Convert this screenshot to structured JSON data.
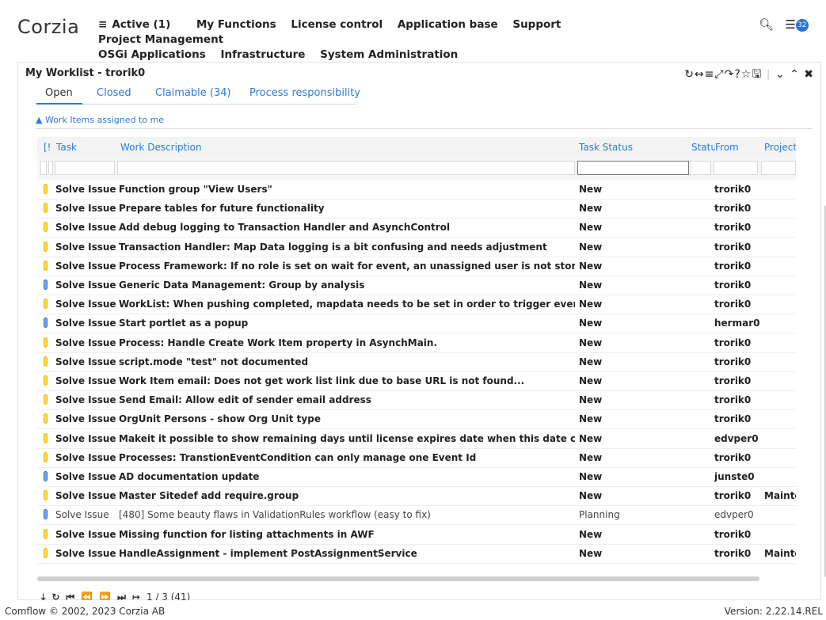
{
  "app": {
    "logo": "Corzia",
    "nav": [
      {
        "icon": "≡",
        "label": "Active (1)"
      },
      {
        "icon": "",
        "label": "My Functions"
      },
      {
        "icon": "",
        "label": "License control"
      },
      {
        "icon": "",
        "label": "Application base"
      },
      {
        "icon": "",
        "label": "Support"
      },
      {
        "icon": "",
        "label": "Project Management"
      },
      {
        "icon": "",
        "label": "OSGi Applications"
      },
      {
        "icon": "",
        "label": "Infrastructure"
      },
      {
        "icon": "",
        "label": "System Administration"
      }
    ],
    "badge": "32"
  },
  "panel": {
    "title": "My Worklist - trorik0",
    "icons": [
      "refresh-icon",
      "resize-icon",
      "menu-icon",
      "fullscreen-icon",
      "share-icon",
      "help-icon",
      "star-icon",
      "save-icon",
      "collapse-icon",
      "expand-icon",
      "close-icon"
    ]
  },
  "tabs": [
    {
      "label": "Open",
      "active": true
    },
    {
      "label": "Closed",
      "active": false
    },
    {
      "label": "Claimable (34)",
      "active": false
    },
    {
      "label": "Process responsibility",
      "active": false
    }
  ],
  "section": {
    "label": "Work Items assigned to me"
  },
  "columns": [
    {
      "key": "prio",
      "label": "[!"
    },
    {
      "key": "task",
      "label": "Task"
    },
    {
      "key": "desc",
      "label": "Work Description"
    },
    {
      "key": "status",
      "label": "Task Status"
    },
    {
      "key": "state",
      "label": "Statu"
    },
    {
      "key": "from",
      "label": "From"
    },
    {
      "key": "project",
      "label": "Project"
    }
  ],
  "rows": [
    {
      "prio": "yellow",
      "task": "Solve Issue",
      "desc": "Function group \"View Users\"",
      "status": "New",
      "from": "trorik0",
      "project": ""
    },
    {
      "prio": "yellow",
      "task": "Solve Issue",
      "desc": "Prepare tables for future functionality",
      "status": "New",
      "from": "trorik0",
      "project": ""
    },
    {
      "prio": "yellow",
      "task": "Solve Issue",
      "desc": "Add debug logging to Transaction Handler and AsynchControl",
      "status": "New",
      "from": "trorik0",
      "project": ""
    },
    {
      "prio": "yellow",
      "task": "Solve Issue",
      "desc": "Transaction Handler: Map Data logging is a bit confusing and needs adjustment",
      "status": "New",
      "from": "trorik0",
      "project": ""
    },
    {
      "prio": "yellow",
      "task": "Solve Issue",
      "desc": "Process Framework: If no role is set on wait for event, an unassigned user is not stored as ToUser",
      "status": "New",
      "from": "trorik0",
      "project": ""
    },
    {
      "prio": "blue",
      "task": "Solve Issue",
      "desc": "Generic Data Management: Group by analysis",
      "status": "New",
      "from": "trorik0",
      "project": ""
    },
    {
      "prio": "yellow",
      "task": "Solve Issue",
      "desc": "WorkList: When pushing completed, mapdata needs to be set in order to trigger event.",
      "status": "New",
      "from": "trorik0",
      "project": ""
    },
    {
      "prio": "blue",
      "task": "Solve Issue",
      "desc": "Start portlet as a popup",
      "status": "New",
      "from": "hermar0",
      "project": ""
    },
    {
      "prio": "yellow",
      "task": "Solve Issue",
      "desc": "Process: Handle Create Work Item property in AsynchMain.",
      "status": "New",
      "from": "trorik0",
      "project": ""
    },
    {
      "prio": "yellow",
      "task": "Solve Issue",
      "desc": "script.mode \"test\" not documented",
      "status": "New",
      "from": "trorik0",
      "project": ""
    },
    {
      "prio": "yellow",
      "task": "Solve Issue",
      "desc": "Work Item email: Does not get work list link due to base URL is not found...",
      "status": "New",
      "from": "trorik0",
      "project": ""
    },
    {
      "prio": "yellow",
      "task": "Solve Issue",
      "desc": "Send Email: Allow edit of sender email address",
      "status": "New",
      "from": "trorik0",
      "project": ""
    },
    {
      "prio": "yellow",
      "task": "Solve Issue",
      "desc": "OrgUnit Persons - show Org Unit type",
      "status": "New",
      "from": "trorik0",
      "project": ""
    },
    {
      "prio": "yellow",
      "task": "Solve Issue",
      "desc": "Makeit it possible to show remaining days until license expires date when this date comes close",
      "status": "New",
      "from": "edvper0",
      "project": ""
    },
    {
      "prio": "yellow",
      "task": "Solve Issue",
      "desc": "Processes: TranstionEventCondition can only manage one Event Id",
      "status": "New",
      "from": "trorik0",
      "project": ""
    },
    {
      "prio": "blue",
      "task": "Solve Issue",
      "desc": "AD documentation update",
      "status": "New",
      "from": "junste0",
      "project": ""
    },
    {
      "prio": "yellow",
      "task": "Solve Issue",
      "desc": "Master Sitedef add require.group",
      "status": "New",
      "from": "trorik0",
      "project": "Maintenar"
    },
    {
      "prio": "blue",
      "task": "Solve Issue",
      "desc": "[480] Some beauty flaws in ValidationRules workflow (easy to fix)",
      "status": "Planning",
      "from": "edvper0",
      "project": "",
      "light": true
    },
    {
      "prio": "yellow",
      "task": "Solve Issue",
      "desc": "Missing function for listing attachments in AWF",
      "status": "New",
      "from": "trorik0",
      "project": ""
    },
    {
      "prio": "yellow",
      "task": "Solve Issue",
      "desc": "HandleAssignment - implement PostAssignmentService",
      "status": "New",
      "from": "trorik0",
      "project": "Maintenar"
    }
  ],
  "pager": {
    "text": "1 / 3  (41)"
  },
  "footer": {
    "copyright": "Comflow © 2002, 2023 Corzia AB",
    "version": "Version: 2.22.14.REL"
  }
}
